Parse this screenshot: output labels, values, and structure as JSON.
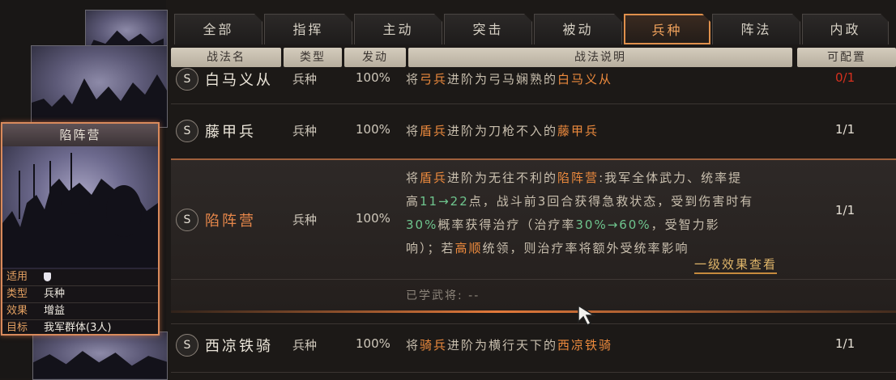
{
  "card": {
    "title": "陷阵营",
    "props": [
      {
        "key": "适用",
        "value": "",
        "icon": "shield-icon"
      },
      {
        "key": "类型",
        "value": "兵种"
      },
      {
        "key": "效果",
        "value": "增益"
      },
      {
        "key": "目标",
        "value": "我军群体(3人)"
      }
    ]
  },
  "tabs": [
    "全部",
    "指挥",
    "主动",
    "突击",
    "被动",
    "兵种",
    "阵法",
    "内政"
  ],
  "active_tab": "兵种",
  "columns": [
    "战法名",
    "类型",
    "发动",
    "战法说明",
    "可配置"
  ],
  "rows": [
    {
      "badge": "S",
      "name": "白马义从",
      "type": "兵种",
      "rate": "100%",
      "desc": [
        {
          "t": "将"
        },
        {
          "t": "弓兵",
          "h": true
        },
        {
          "t": "进阶为弓马娴熟的"
        },
        {
          "t": "白马义从",
          "h": true
        }
      ],
      "config": "0/1",
      "config_color": "#d6301e"
    },
    {
      "badge": "S",
      "name": "藤甲兵",
      "type": "兵种",
      "rate": "100%",
      "desc": [
        {
          "t": "将"
        },
        {
          "t": "盾兵",
          "h": true
        },
        {
          "t": "进阶为刀枪不入的"
        },
        {
          "t": "藤甲兵",
          "h": true
        }
      ],
      "config": "1/1"
    },
    {
      "badge": "S",
      "name": "陷阵营",
      "type": "兵种",
      "rate": "100%",
      "config": "1/1",
      "lines": [
        [
          {
            "t": "将"
          },
          {
            "t": "盾兵",
            "h": true
          },
          {
            "t": "进阶为无往不利的"
          },
          {
            "t": "陷阵营",
            "h": true
          },
          {
            "t": ":我军全体武力、统率提"
          }
        ],
        [
          {
            "t": "高"
          },
          {
            "t": "11→22",
            "g": true
          },
          {
            "t": "点，战斗前3回合获得急救状态，受到伤害时有"
          }
        ],
        [
          {
            "t": "30%",
            "g": true
          },
          {
            "t": "概率获得治疗（治疗率"
          },
          {
            "t": "30%→60%",
            "g": true
          },
          {
            "t": "，受智力影"
          }
        ],
        [
          {
            "t": "响）；若"
          },
          {
            "t": "高顺",
            "h": true
          },
          {
            "t": "统领，则治疗率将额外受统率影响"
          }
        ]
      ],
      "link": "一级效果查看",
      "learned": "已学武将:  --"
    },
    {
      "badge": "S",
      "name": "西凉铁骑",
      "type": "兵种",
      "rate": "100%",
      "desc": [
        {
          "t": "将"
        },
        {
          "t": "骑兵",
          "h": true
        },
        {
          "t": "进阶为横行天下的"
        },
        {
          "t": "西凉铁骑",
          "h": true
        }
      ],
      "config": "1/1"
    }
  ]
}
